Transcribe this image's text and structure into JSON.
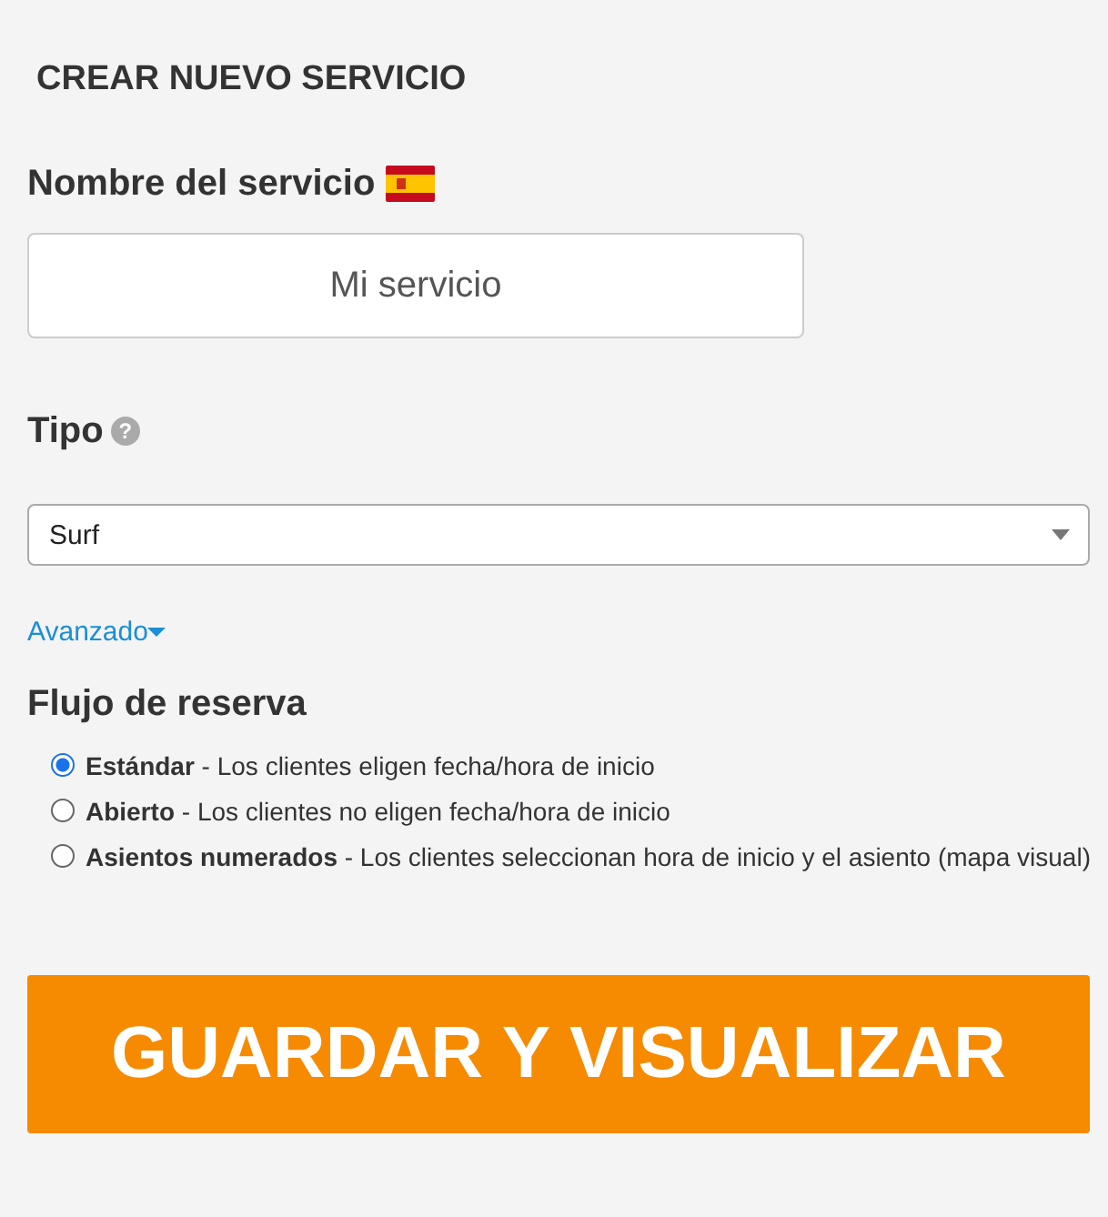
{
  "title": "CREAR NUEVO SERVICIO",
  "name_field": {
    "label": "Nombre del servicio",
    "value": "Mi servicio"
  },
  "type_field": {
    "label": "Tipo",
    "help_symbol": "?",
    "value": "Surf"
  },
  "advanced_link": {
    "label": "Avanzado",
    "expanded": false
  },
  "booking_flow": {
    "heading": "Flujo de reserva",
    "options": [
      {
        "text": "**Estándar** - Los clientes eligen fecha/hora de inicio",
        "selected": true
      },
      {
        "text": "**Abierto** - Los clientes no eligen fecha/hora de inicio",
        "selected": false
      },
      {
        "text": "**Asientos numerados** - Los clientes seleccionan hora de inicio y el asiento (mapa visual)",
        "selected": false
      }
    ]
  },
  "save_button": "GUARDAR Y VISUALIZAR"
}
